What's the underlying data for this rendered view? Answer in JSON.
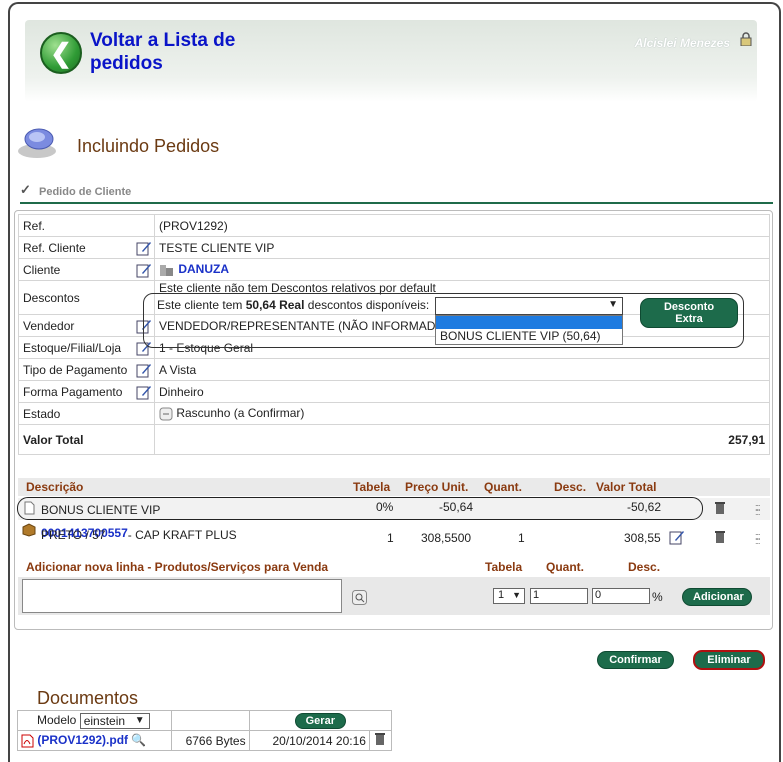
{
  "header": {
    "back_label": "Voltar a Lista de pedidos",
    "user_name": "Alcislei Menezes"
  },
  "page": {
    "title": "Incluindo Pedidos",
    "subtitle": "Pedido de Cliente"
  },
  "order": {
    "ref_label": "Ref.",
    "ref_value": "(PROV1292)",
    "ref_cliente_label": "Ref. Cliente",
    "ref_cliente_value": "TESTE CLIENTE VIP",
    "cliente_label": "Cliente",
    "cliente_value": "DANUZA",
    "descontos_label": "Descontos",
    "descontos_note": "Este cliente não tem Descontos relativos por default",
    "descontos_available_prefix": "Este cliente tem",
    "descontos_available_amount": "50,64 Real",
    "descontos_available_suffix": "descontos disponíveis:",
    "descontos_select_value": "",
    "descontos_options": [
      "BONUS CLIENTE VIP (50,64)"
    ],
    "desconto_extra_button": "Desconto Extra",
    "vendedor_label": "Vendedor",
    "vendedor_value": "VENDEDOR/REPRESENTANTE (NÃO INFORMADO)",
    "estoque_label": "Estoque/Filial/Loja",
    "estoque_value": "1 - Estoque Geral",
    "tipo_pagamento_label": "Tipo de Pagamento",
    "tipo_pagamento_value": "A Vista",
    "forma_pagamento_label": "Forma Pagamento",
    "forma_pagamento_value": "Dinheiro",
    "estado_label": "Estado",
    "estado_value": "Rascunho (a Confirmar)",
    "valor_total_label": "Valor Total",
    "valor_total_value": "257,91"
  },
  "items": {
    "headers": {
      "descricao": "Descrição",
      "tabela": "Tabela",
      "preco_unit": "Preço Unit.",
      "quant": "Quant.",
      "desc": "Desc.",
      "valor_total": "Valor Total"
    },
    "rows": [
      {
        "descricao": "BONUS CLIENTE VIP",
        "tabela": "0%",
        "preco_unit": "-50,64",
        "quant": "",
        "desc": "",
        "valor_total": "-50,62"
      },
      {
        "codigo": "0001413700557",
        "descricao": "- CAP KRAFT PLUS",
        "descricao_line2": "PRETO / 57",
        "tabela": "1",
        "preco_unit": "308,5500",
        "quant": "1",
        "desc": "",
        "valor_total": "308,55"
      }
    ]
  },
  "add_line": {
    "title": "Adicionar nova linha - Produtos/Serviços para Venda",
    "tabela_label": "Tabela",
    "quant_label": "Quant.",
    "desc_label": "Desc.",
    "tabela_value": "1",
    "quant_value": "1",
    "desc_value": "0",
    "percent": "%",
    "add_button": "Adicionar"
  },
  "actions": {
    "confirmar": "Confirmar",
    "eliminar": "Eliminar"
  },
  "documents": {
    "title": "Documentos",
    "modelo_label": "Modelo",
    "modelo_value": "einstein",
    "gerar_button": "Gerar",
    "files": [
      {
        "name": "(PROV1292).pdf",
        "size": "6766 Bytes",
        "date": "20/10/2014 20:16"
      }
    ]
  }
}
